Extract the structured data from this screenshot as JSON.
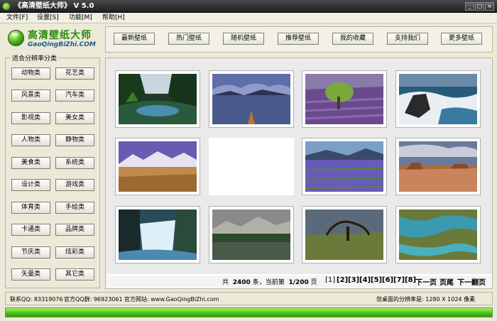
{
  "window": {
    "title": "《高清壁纸大师》 V 5.0",
    "controls": [
      "_",
      "□",
      "×"
    ]
  },
  "menu": [
    "文件[F]",
    "设置[S]",
    "功能[M]",
    "帮助[H]"
  ],
  "logo": {
    "name": "高清壁纸大师",
    "domain": "GaoQingBiZhi.COM"
  },
  "topnav": [
    "最新壁纸",
    "热门壁纸",
    "随机壁纸",
    "推荐壁纸",
    "我的收藏",
    "支持我们",
    "更多壁纸"
  ],
  "categories": {
    "title": "适合分辨率分类",
    "items": [
      "动物类",
      "花艺类",
      "风景类",
      "汽车类",
      "影视类",
      "美女类",
      "人物类",
      "静物类",
      "美食类",
      "系统类",
      "设计类",
      "游戏类",
      "体育类",
      "手绘类",
      "卡通类",
      "品牌类",
      "节庆类",
      "炫彩类",
      "矢量类",
      "其它类"
    ]
  },
  "thumbnails": [
    {
      "scene": "forest-pond",
      "empty": false
    },
    {
      "scene": "lake-canoe",
      "empty": false
    },
    {
      "scene": "lavender-tree",
      "empty": false
    },
    {
      "scene": "sea-cliff",
      "empty": false
    },
    {
      "scene": "snow-mountains-plain",
      "empty": false
    },
    {
      "scene": "blank",
      "empty": true
    },
    {
      "scene": "lupine-field",
      "empty": false
    },
    {
      "scene": "desert-canyon",
      "empty": false
    },
    {
      "scene": "waterfall",
      "empty": false
    },
    {
      "scene": "mountain-lake-trees",
      "empty": false
    },
    {
      "scene": "savanna-tree",
      "empty": false
    },
    {
      "scene": "aerial-river",
      "empty": false
    }
  ],
  "pager": {
    "prefix": "共",
    "total": "2400",
    "unit": "条，当前第",
    "page": "1/200",
    "suffix": "页",
    "links": [
      "[1]",
      "[2]",
      "[3]",
      "[4]",
      "[5]",
      "[6]",
      "[7]",
      "[8]",
      "下一页",
      "页尾",
      "下一翻页"
    ]
  },
  "status": {
    "qq": "联系QQ: 83319076",
    "qq_group": "官方QQ群: 96923061",
    "website": "官方网站: www.GaoQingBiZhi.com",
    "resolution": "您桌面的分辨率是: 1280 X 1024 像素"
  },
  "progress": {
    "percent": 100
  },
  "colors": {
    "accent_green": "#2a8a0c",
    "progress_green": "#4bc21a",
    "titlebar": "#2b2b2b"
  }
}
